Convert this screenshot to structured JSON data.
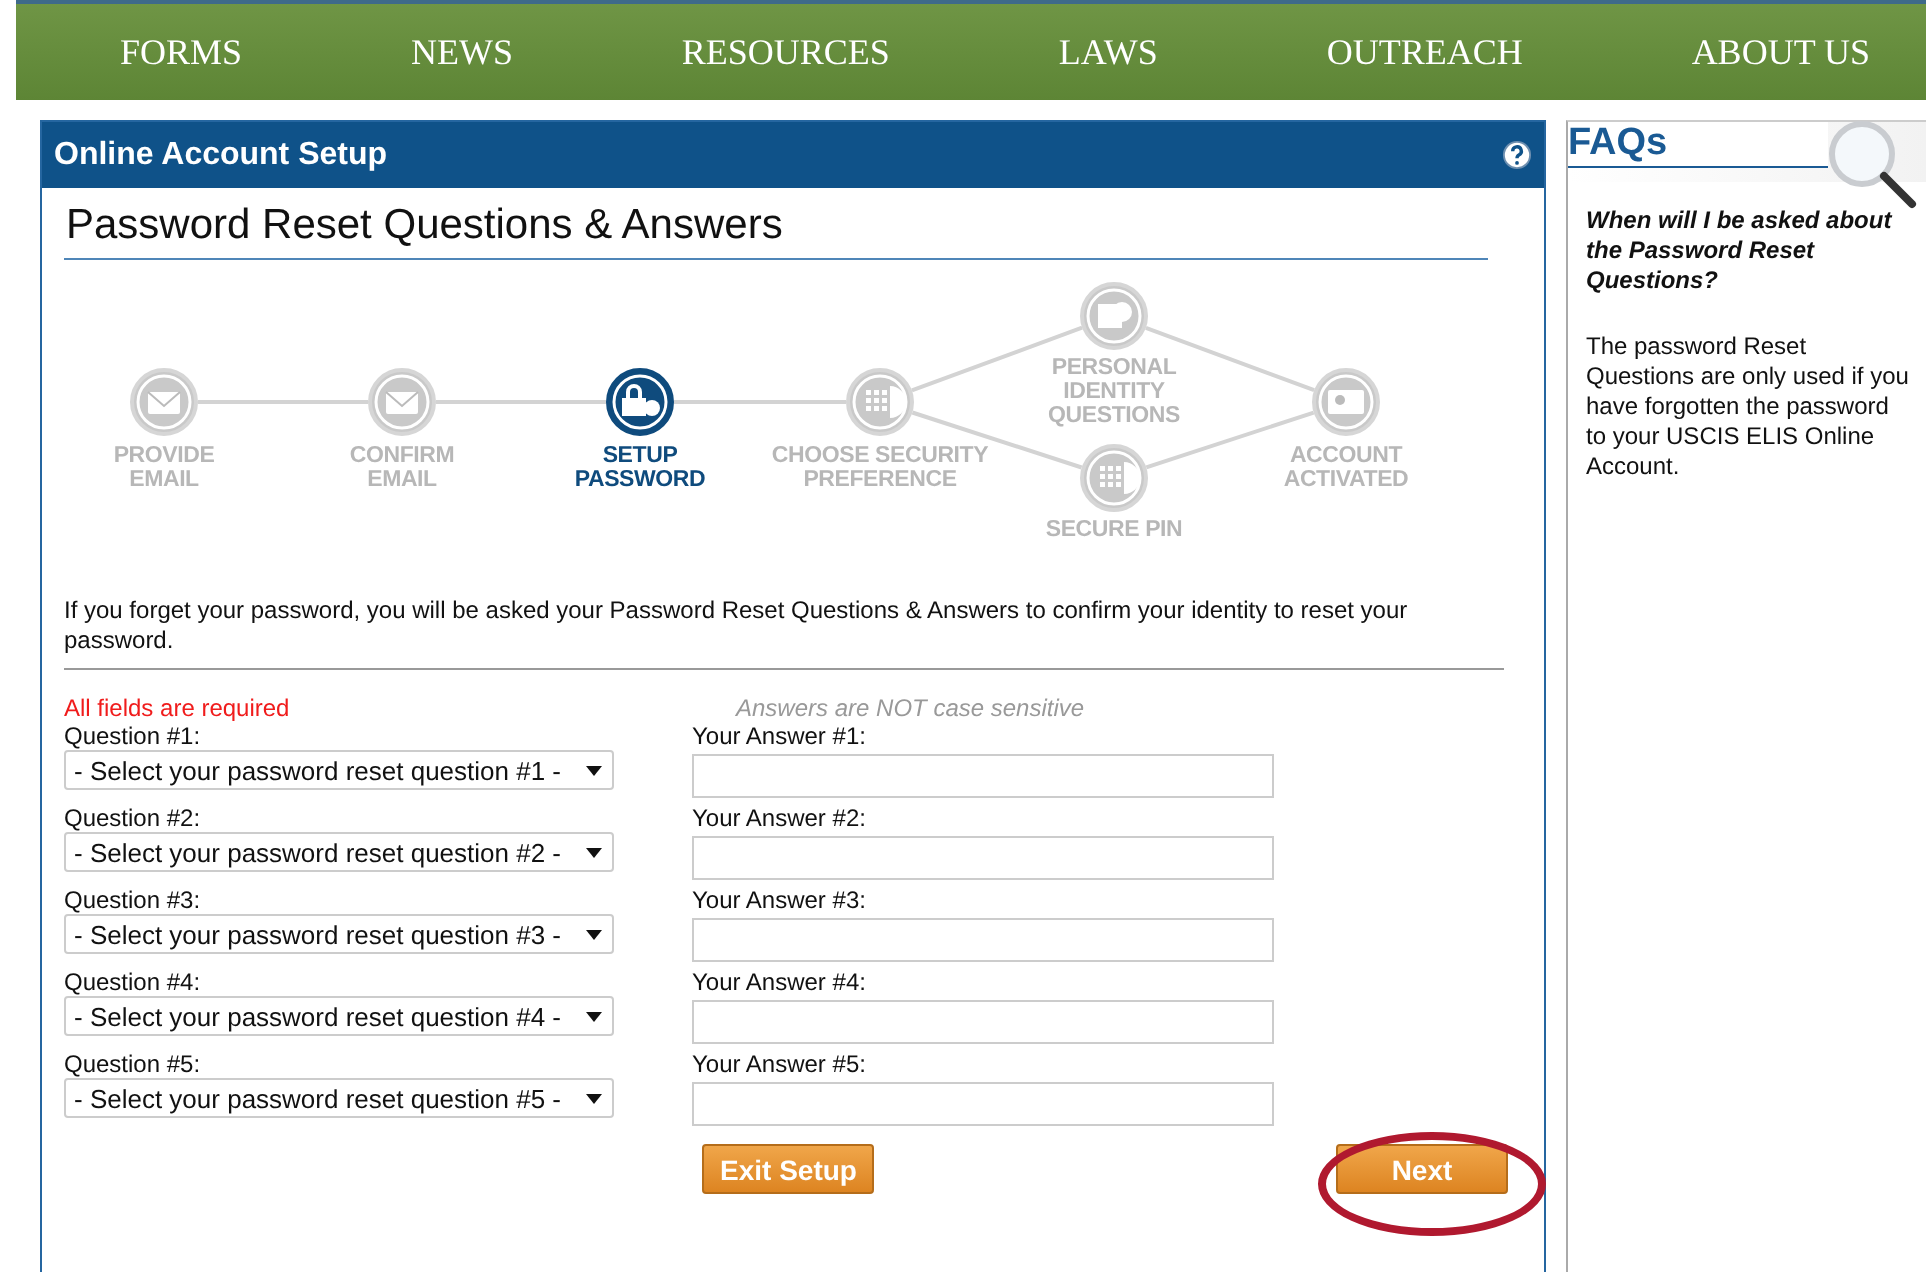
{
  "nav": [
    "FORMS",
    "NEWS",
    "RESOURCES",
    "LAWS",
    "OUTREACH",
    "ABOUT US"
  ],
  "panel": {
    "title": "Online Account Setup",
    "heading": "Password Reset Questions & Answers"
  },
  "steps": [
    {
      "lines": [
        "PROVIDE",
        "EMAIL"
      ],
      "selected": false
    },
    {
      "lines": [
        "CONFIRM",
        "EMAIL"
      ],
      "selected": false
    },
    {
      "lines": [
        "SETUP",
        "PASSWORD"
      ],
      "selected": true
    },
    {
      "lines": [
        "CHOOSE SECURITY",
        "PREFERENCE"
      ],
      "selected": false
    },
    {
      "lines": [
        "PERSONAL",
        "IDENTITY",
        "QUESTIONS"
      ],
      "selected": false
    },
    {
      "lines": [
        "SECURE PIN"
      ],
      "selected": false
    },
    {
      "lines": [
        "ACCOUNT",
        "ACTIVATED"
      ],
      "selected": false
    }
  ],
  "intro": "If you forget your password, you will be asked your Password Reset Questions & Answers to confirm your identity to reset your password.",
  "required_note": "All fields are required",
  "case_note": "Answers are NOT case sensitive",
  "questions": [
    {
      "label": "Question #1:",
      "value": "- Select your password reset question #1 -",
      "answer_label": "Your Answer #1:"
    },
    {
      "label": "Question #2:",
      "value": "- Select your password reset question #2 -",
      "answer_label": "Your Answer #2:"
    },
    {
      "label": "Question #3:",
      "value": "- Select your password reset question #3 -",
      "answer_label": "Your Answer #3:"
    },
    {
      "label": "Question #4:",
      "value": "- Select your password reset question #4 -",
      "answer_label": "Your Answer #4:"
    },
    {
      "label": "Question #5:",
      "value": "- Select your password reset question #5 -",
      "answer_label": "Your Answer #5:"
    }
  ],
  "buttons": [
    {
      "label": "Exit Setup",
      "highlighted": false
    },
    {
      "label": "Next",
      "highlighted": true
    }
  ],
  "faq": {
    "title": "FAQs",
    "question": "When will I be asked about the Password Reset Questions?",
    "answer": "The password Reset Questions are only used if you have forgotten the password to your USCIS ELIS Online Account."
  }
}
